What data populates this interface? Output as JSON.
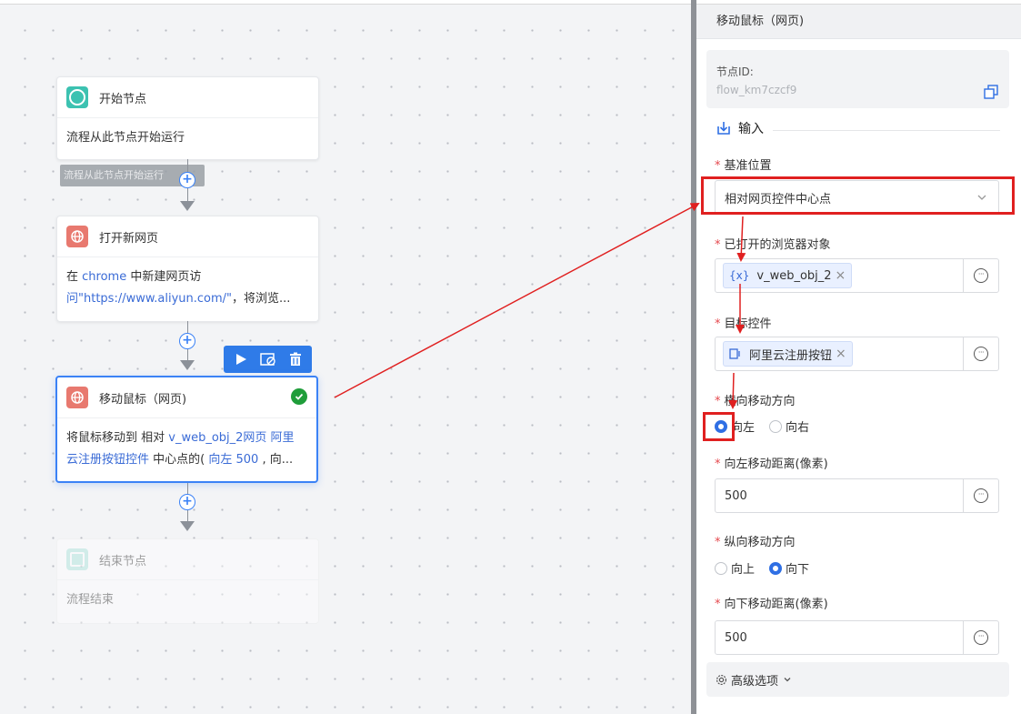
{
  "canvas": {
    "start_node": {
      "title": "开始节点",
      "desc": "流程从此节点开始运行"
    },
    "tooltip": "流程从此节点开始运行",
    "open_node": {
      "title": "打开新网页",
      "desc_a": "在 ",
      "desc_link1": "chrome",
      "desc_b": " 中新建网页访",
      "desc_link2": "问\"https://www.aliyun.com/\"",
      "desc_c": "，将浏览..."
    },
    "move_node": {
      "title": "移动鼠标（网页)",
      "desc_a": "将鼠标移动到 相对 ",
      "desc_link1": "v_web_obj_2网页 阿里",
      "desc_link2": "云注册按钮控件",
      "desc_b": " 中心点的( ",
      "desc_link3": "向左 500",
      "desc_c": " , 向..."
    },
    "end_node": {
      "title": "结束节点",
      "desc": "流程结束"
    }
  },
  "panel": {
    "title": "移动鼠标（网页)",
    "node_id_label": "节点ID:",
    "node_id_value": "flow_km7czcf9",
    "section_input": "输入",
    "base_position": {
      "label": "基准位置",
      "value": "相对网页控件中心点"
    },
    "browser_obj": {
      "label": "已打开的浏览器对象",
      "tag_icon": "{x}",
      "value": "v_web_obj_2"
    },
    "target_ctrl": {
      "label": "目标控件",
      "value": "阿里云注册按钮"
    },
    "h_direction": {
      "label": "横向移动方向",
      "opt_left": "向左",
      "opt_right": "向右"
    },
    "left_distance": {
      "label": "向左移动距离(像素)",
      "value": "500"
    },
    "v_direction": {
      "label": "纵向移动方向",
      "opt_up": "向上",
      "opt_down": "向下"
    },
    "down_distance": {
      "label": "向下移动距离(像素)",
      "value": "500"
    },
    "advanced": "高级选项"
  },
  "colors": {
    "accent": "#2f6fe4",
    "annotation": "#e02020",
    "start": "#3cc2b1",
    "web": "#e8796f"
  }
}
